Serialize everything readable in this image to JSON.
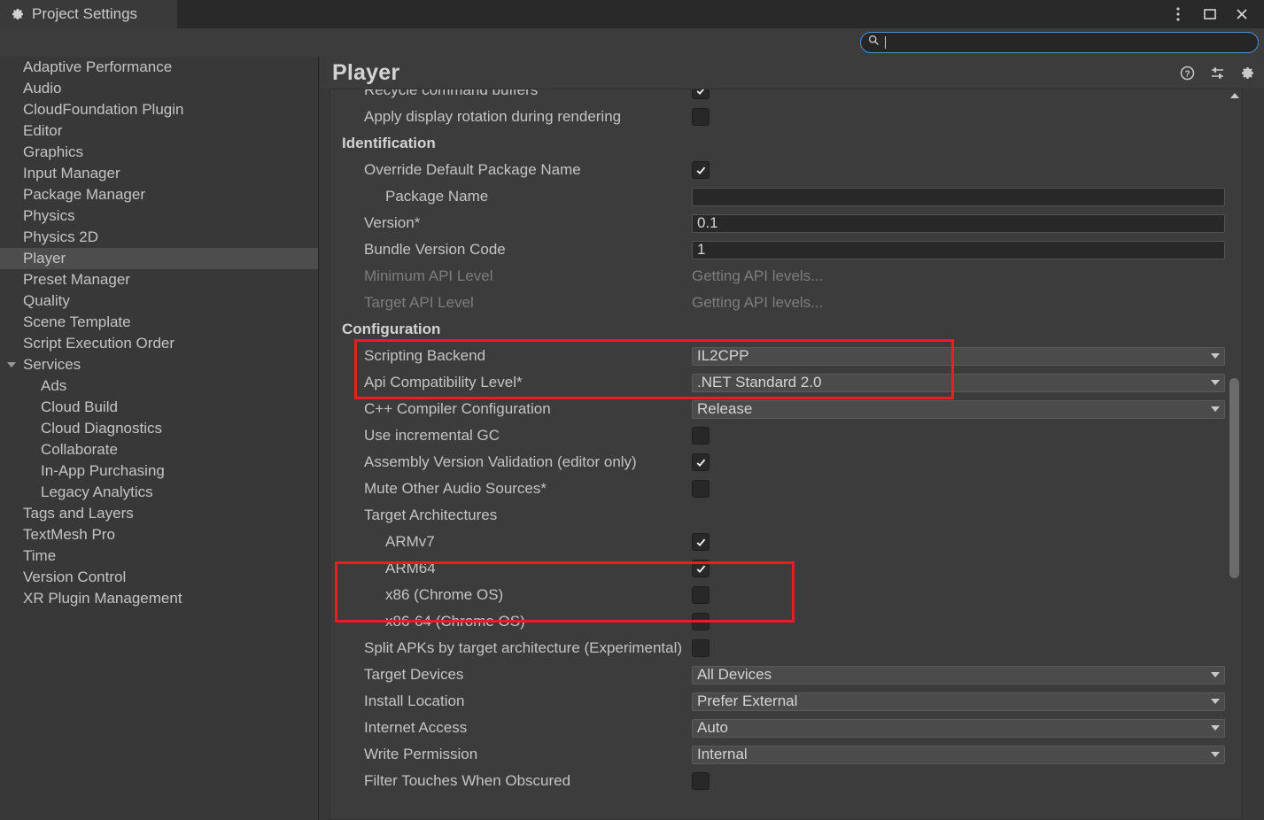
{
  "window": {
    "tab_title": "Project Settings",
    "tab_icon": "gear-icon",
    "controls": {
      "menu": "more-vertical-icon",
      "maximize": "maximize-icon",
      "close": "close-icon"
    }
  },
  "search": {
    "icon": "search-icon",
    "value": "",
    "placeholder": ""
  },
  "sidebar": {
    "items": [
      {
        "label": "Adaptive Performance",
        "level": 0,
        "selected": false
      },
      {
        "label": "Audio",
        "level": 0,
        "selected": false
      },
      {
        "label": "CloudFoundation Plugin",
        "level": 0,
        "selected": false
      },
      {
        "label": "Editor",
        "level": 0,
        "selected": false
      },
      {
        "label": "Graphics",
        "level": 0,
        "selected": false
      },
      {
        "label": "Input Manager",
        "level": 0,
        "selected": false
      },
      {
        "label": "Package Manager",
        "level": 0,
        "selected": false
      },
      {
        "label": "Physics",
        "level": 0,
        "selected": false
      },
      {
        "label": "Physics 2D",
        "level": 0,
        "selected": false
      },
      {
        "label": "Player",
        "level": 0,
        "selected": true
      },
      {
        "label": "Preset Manager",
        "level": 0,
        "selected": false
      },
      {
        "label": "Quality",
        "level": 0,
        "selected": false
      },
      {
        "label": "Scene Template",
        "level": 0,
        "selected": false
      },
      {
        "label": "Script Execution Order",
        "level": 0,
        "selected": false
      },
      {
        "label": "Services",
        "level": 0,
        "selected": false,
        "expanded": true
      },
      {
        "label": "Ads",
        "level": 1,
        "selected": false
      },
      {
        "label": "Cloud Build",
        "level": 1,
        "selected": false
      },
      {
        "label": "Cloud Diagnostics",
        "level": 1,
        "selected": false
      },
      {
        "label": "Collaborate",
        "level": 1,
        "selected": false
      },
      {
        "label": "In-App Purchasing",
        "level": 1,
        "selected": false
      },
      {
        "label": "Legacy Analytics",
        "level": 1,
        "selected": false
      },
      {
        "label": "Tags and Layers",
        "level": 0,
        "selected": false
      },
      {
        "label": "TextMesh Pro",
        "level": 0,
        "selected": false
      },
      {
        "label": "Time",
        "level": 0,
        "selected": false
      },
      {
        "label": "Version Control",
        "level": 0,
        "selected": false
      },
      {
        "label": "XR Plugin Management",
        "level": 0,
        "selected": false
      }
    ]
  },
  "panel": {
    "title": "Player",
    "icons": [
      {
        "name": "help-icon"
      },
      {
        "name": "preset-icon"
      },
      {
        "name": "gear-icon"
      }
    ]
  },
  "scrollbar": {
    "up_arrow": "triangle-up-icon",
    "thumb_top_pct": 39,
    "thumb_height_pct": 27
  },
  "rows": [
    {
      "kind": "checkbox",
      "label": "Recycle command buffers*",
      "indent": 1,
      "checked": true
    },
    {
      "kind": "checkbox",
      "label": "Apply display rotation during rendering",
      "indent": 1,
      "checked": false
    },
    {
      "kind": "section",
      "label": "Identification"
    },
    {
      "kind": "checkbox",
      "label": "Override Default Package Name",
      "indent": 1,
      "checked": true
    },
    {
      "kind": "text",
      "label": "Package Name",
      "indent": 2,
      "value": ""
    },
    {
      "kind": "text",
      "label": "Version*",
      "indent": 1,
      "value": "0.1"
    },
    {
      "kind": "text",
      "label": "Bundle Version Code",
      "indent": 1,
      "value": "1"
    },
    {
      "kind": "static",
      "label": "Minimum API Level",
      "indent": 1,
      "value": "Getting API levels...",
      "disabled": true
    },
    {
      "kind": "static",
      "label": "Target API Level",
      "indent": 1,
      "value": "Getting API levels...",
      "disabled": true
    },
    {
      "kind": "section",
      "label": "Configuration"
    },
    {
      "kind": "dropdown",
      "label": "Scripting Backend",
      "indent": 1,
      "value": "IL2CPP"
    },
    {
      "kind": "dropdown",
      "label": "Api Compatibility Level*",
      "indent": 1,
      "value": ".NET Standard 2.0"
    },
    {
      "kind": "dropdown",
      "label": "C++ Compiler Configuration",
      "indent": 1,
      "value": "Release"
    },
    {
      "kind": "checkbox",
      "label": "Use incremental GC",
      "indent": 1,
      "checked": false
    },
    {
      "kind": "checkbox",
      "label": "Assembly Version Validation (editor only)",
      "indent": 1,
      "checked": true
    },
    {
      "kind": "checkbox",
      "label": "Mute Other Audio Sources*",
      "indent": 1,
      "checked": false
    },
    {
      "kind": "label",
      "label": "Target Architectures",
      "indent": 1
    },
    {
      "kind": "checkbox",
      "label": "ARMv7",
      "indent": 2,
      "checked": true
    },
    {
      "kind": "checkbox",
      "label": "ARM64",
      "indent": 2,
      "checked": true
    },
    {
      "kind": "checkbox",
      "label": "x86 (Chrome OS)",
      "indent": 2,
      "checked": false
    },
    {
      "kind": "checkbox",
      "label": "x86-64 (Chrome OS)",
      "indent": 2,
      "checked": false
    },
    {
      "kind": "checkbox",
      "label": "Split APKs by target architecture (Experimental)",
      "indent": 1,
      "checked": false
    },
    {
      "kind": "dropdown",
      "label": "Target Devices",
      "indent": 1,
      "value": "All Devices"
    },
    {
      "kind": "dropdown",
      "label": "Install Location",
      "indent": 1,
      "value": "Prefer External"
    },
    {
      "kind": "dropdown",
      "label": "Internet Access",
      "indent": 1,
      "value": "Auto"
    },
    {
      "kind": "dropdown",
      "label": "Write Permission",
      "indent": 1,
      "value": "Internal"
    },
    {
      "kind": "checkbox",
      "label": "Filter Touches When Obscured",
      "indent": 1,
      "checked": false
    }
  ],
  "annotations": [
    {
      "name": "scripting-backend-highlight",
      "color": "#ed1c24"
    },
    {
      "name": "target-architectures-highlight",
      "color": "#ed1c24"
    }
  ]
}
